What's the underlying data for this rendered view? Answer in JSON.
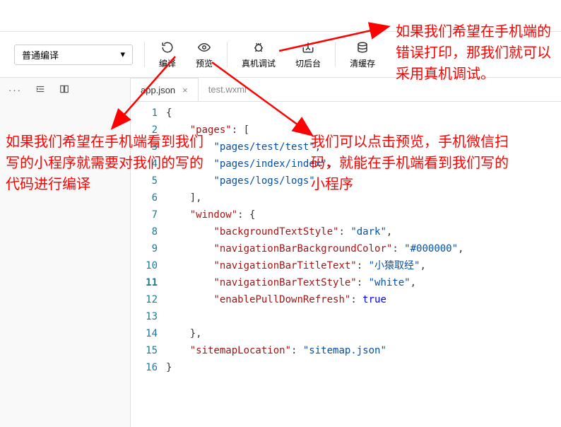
{
  "toolbar": {
    "compile_mode": "普通编译",
    "compile": "编译",
    "preview": "预览",
    "debug": "真机调试",
    "background": "切后台",
    "clear_cache": "清缓存"
  },
  "sidebar": {
    "dots": "···"
  },
  "tabs": [
    {
      "label": "app.json",
      "active": true
    },
    {
      "label": "test.wxml",
      "active": false
    }
  ],
  "code_lines": [
    {
      "num": 1,
      "indent": 0,
      "tokens": [
        {
          "t": "{",
          "c": "p"
        }
      ]
    },
    {
      "num": 2,
      "indent": 1,
      "tokens": [
        {
          "t": "\"pages\"",
          "c": "k"
        },
        {
          "t": ": [",
          "c": "p"
        }
      ]
    },
    {
      "num": 3,
      "indent": 2,
      "tokens": [
        {
          "t": "\"pages/test/test\"",
          "c": "s"
        },
        {
          "t": ",",
          "c": "p"
        }
      ]
    },
    {
      "num": 4,
      "indent": 2,
      "tokens": [
        {
          "t": "\"pages/index/index\"",
          "c": "s"
        },
        {
          "t": ",",
          "c": "p"
        }
      ]
    },
    {
      "num": 5,
      "indent": 2,
      "tokens": [
        {
          "t": "\"pages/logs/logs\"",
          "c": "s"
        }
      ]
    },
    {
      "num": 6,
      "indent": 1,
      "tokens": [
        {
          "t": "],",
          "c": "p"
        }
      ]
    },
    {
      "num": 7,
      "indent": 1,
      "tokens": [
        {
          "t": "\"window\"",
          "c": "k"
        },
        {
          "t": ": {",
          "c": "p"
        }
      ]
    },
    {
      "num": 8,
      "indent": 2,
      "tokens": [
        {
          "t": "\"backgroundTextStyle\"",
          "c": "k"
        },
        {
          "t": ": ",
          "c": "p"
        },
        {
          "t": "\"dark\"",
          "c": "s"
        },
        {
          "t": ",",
          "c": "p"
        }
      ]
    },
    {
      "num": 9,
      "indent": 2,
      "tokens": [
        {
          "t": "\"navigationBarBackgroundColor\"",
          "c": "k"
        },
        {
          "t": ": ",
          "c": "p"
        },
        {
          "t": "\"#000000\"",
          "c": "s"
        },
        {
          "t": ",",
          "c": "p"
        }
      ]
    },
    {
      "num": 10,
      "indent": 2,
      "tokens": [
        {
          "t": "\"navigationBarTitleText\"",
          "c": "k"
        },
        {
          "t": ": ",
          "c": "p"
        },
        {
          "t": "\"小猿取经\"",
          "c": "s"
        },
        {
          "t": ",",
          "c": "p"
        }
      ]
    },
    {
      "num": 11,
      "indent": 2,
      "tokens": [
        {
          "t": "\"navigationBarTextStyle\"",
          "c": "k"
        },
        {
          "t": ": ",
          "c": "p"
        },
        {
          "t": "\"white\"",
          "c": "s"
        },
        {
          "t": ",",
          "c": "p"
        }
      ]
    },
    {
      "num": 12,
      "indent": 2,
      "tokens": [
        {
          "t": "\"enablePullDownRefresh\"",
          "c": "k"
        },
        {
          "t": ": ",
          "c": "p"
        },
        {
          "t": "true",
          "c": "b"
        }
      ]
    },
    {
      "num": 13,
      "indent": 0,
      "tokens": []
    },
    {
      "num": 14,
      "indent": 1,
      "tokens": [
        {
          "t": "},",
          "c": "p"
        }
      ]
    },
    {
      "num": 15,
      "indent": 1,
      "tokens": [
        {
          "t": "\"sitemapLocation\"",
          "c": "k"
        },
        {
          "t": ": ",
          "c": "p"
        },
        {
          "t": "\"sitemap.json\"",
          "c": "s"
        }
      ]
    },
    {
      "num": 16,
      "indent": 0,
      "tokens": [
        {
          "t": "}",
          "c": "p"
        }
      ]
    }
  ],
  "annotations": {
    "a1": "如果我们希望在手机端看到我们写的小程序就需要对我们的写的代码进行编译",
    "a2": "我们可以点击预览，手机微信扫码，就能在手机端看到我们写的小程序",
    "a3": "如果我们希望在手机端的错误打印，那我们就可以采用真机调试。"
  }
}
